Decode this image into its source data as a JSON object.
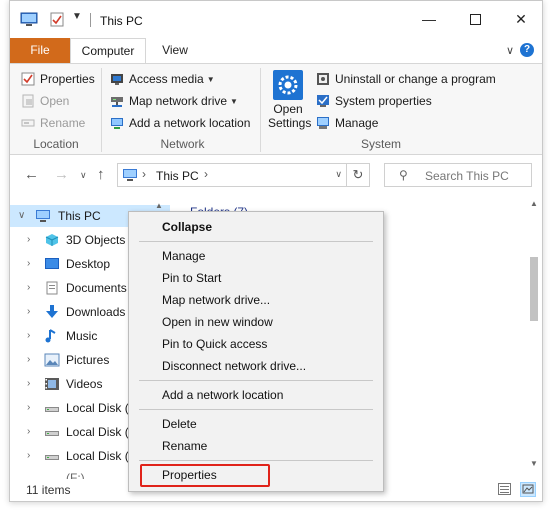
{
  "window": {
    "title": "This PC"
  },
  "tabs": {
    "file": "File",
    "computer": "Computer",
    "view": "View"
  },
  "ribbon": {
    "location": {
      "label": "Location",
      "properties": "Properties",
      "open": "Open",
      "rename": "Rename"
    },
    "network": {
      "label": "Network",
      "access_media": "Access media",
      "map_network_drive": "Map network drive",
      "add_network_location": "Add a network location"
    },
    "system": {
      "label": "System",
      "open_settings_line1": "Open",
      "open_settings_line2": "Settings",
      "uninstall": "Uninstall or change a program",
      "system_properties": "System properties",
      "manage": "Manage"
    }
  },
  "address": {
    "path": "This PC"
  },
  "search": {
    "placeholder": "Search This PC"
  },
  "navpane": {
    "items": [
      {
        "label": "This PC",
        "icon": "computer-icon"
      },
      {
        "label": "3D Objects",
        "icon": "3d-objects-icon"
      },
      {
        "label": "Desktop",
        "icon": "desktop-icon"
      },
      {
        "label": "Documents",
        "icon": "documents-icon"
      },
      {
        "label": "Downloads",
        "icon": "downloads-icon"
      },
      {
        "label": "Music",
        "icon": "music-icon"
      },
      {
        "label": "Pictures",
        "icon": "pictures-icon"
      },
      {
        "label": "Videos",
        "icon": "videos-icon"
      },
      {
        "label": "Local Disk (",
        "icon": "disk-icon"
      },
      {
        "label": "Local Disk (",
        "icon": "disk-icon"
      },
      {
        "label": "Local Disk (",
        "icon": "disk-icon"
      },
      {
        "label": "        (F:)",
        "icon": "disk-icon"
      }
    ]
  },
  "content": {
    "header": "Folders (7)"
  },
  "status": {
    "items": "11 items"
  },
  "context_menu": {
    "items": [
      "Collapse",
      "Manage",
      "Pin to Start",
      "Map network drive...",
      "Open in new window",
      "Pin to Quick access",
      "Disconnect network drive...",
      "Add a network location",
      "Delete",
      "Rename",
      "Properties"
    ]
  },
  "colors": {
    "file_tab": "#d26a1b",
    "selection": "#cce8ff",
    "highlight": "#e0231a",
    "accent": "#1e73d2"
  }
}
